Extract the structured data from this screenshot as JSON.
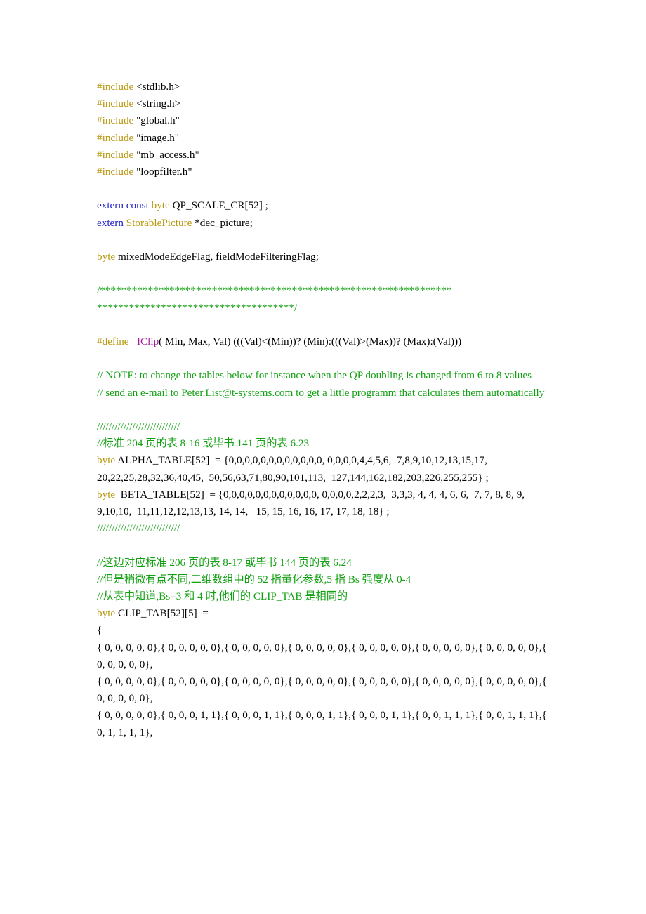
{
  "document": {
    "type": "source-code-listing",
    "language": "C",
    "page_background": "#ffffff",
    "colors": {
      "keyword": "#B8960C",
      "extern_keyword": "#2222CC",
      "macro_name": "#A0209C",
      "comment": "#12A012",
      "text": "#000000"
    }
  },
  "code": {
    "includes": [
      {
        "directive": "#include",
        "target": "<stdlib.h>"
      },
      {
        "directive": "#include",
        "target": "<string.h>"
      },
      {
        "directive": "#include",
        "target": "\"global.h\""
      },
      {
        "directive": "#include",
        "target": "\"image.h\""
      },
      {
        "directive": "#include",
        "target": "\"mb_access.h\""
      },
      {
        "directive": "#include",
        "target": "\"loopfilter.h\""
      }
    ],
    "externs": {
      "line1_kw": "extern const",
      "line1_type": "byte",
      "line1_rest": "QP_SCALE_CR[52] ;",
      "line2_kw": "extern",
      "line2_type": "StorablePicture",
      "line2_rest": "*dec_picture;"
    },
    "globals": {
      "type": "byte",
      "decl": "mixedModeEdgeFlag, fieldModeFilteringFlag;"
    },
    "banner": {
      "line1": "/******************************************************************",
      "line2": "*************************************/"
    },
    "define": {
      "directive": "#define",
      "name": "IClip",
      "body": "( Min, Max, Val) (((Val)<(Min))? (Min):(((Val)>(Max))? (Max):(Val)))"
    },
    "note_comment": {
      "line1": "// NOTE: to change the tables below for instance when the QP doubling is changed from 6 to 8 values",
      "line2": "//        send an e-mail to Peter.List@t-systems.com to get a little programm that calculates them automatically"
    },
    "separator_1": "////////////////////////////",
    "chinese_comment_1": "//标准 204 页的表 8-16 或毕书 141 页的表 6.23",
    "alpha_table": {
      "type": "byte",
      "name": "ALPHA_TABLE[52]",
      "assign": "=",
      "values": "{0,0,0,0,0,0,0,0,0,0,0,0, 0,0,0,0,4,4,5,6,  7,8,9,10,12,13,15,17,  20,22,25,28,32,36,40,45,  50,56,63,71,80,90,101,113,  127,144,162,182,203,226,255,255} ;"
    },
    "beta_table": {
      "type": "byte",
      "name": "BETA_TABLE[52]",
      "assign": "=",
      "values": "{0,0,0,0,0,0,0,0,0,0,0,0, 0,0,0,0,2,2,2,3,  3,3,3, 4, 4, 4, 6, 6,  7, 7, 8, 8, 9, 9,10,10,  11,11,12,12,13,13, 14, 14,   15, 15, 16, 16, 17, 17, 18, 18} ;"
    },
    "separator_2": "////////////////////////////",
    "chinese_comment_2": "//这边对应标准 206 页的表 8-17 或毕书 144 页的表 6.24",
    "chinese_comment_3": "//但是稍微有点不同,二维数组中的 52 指量化参数,5 指 Bs 强度从 0-4",
    "chinese_comment_4": "//从表中知道,Bs=3 和 4 时,他们的 CLIP_TAB 是相同的",
    "clip_tab": {
      "type": "byte",
      "name": "CLIP_TAB[52][5]",
      "assign": "=",
      "open_brace": "{",
      "rows": [
        "  { 0, 0, 0, 0, 0},{ 0, 0, 0, 0, 0},{ 0, 0, 0, 0, 0},{ 0, 0, 0, 0, 0},{ 0, 0, 0, 0, 0},{ 0, 0, 0, 0, 0},{ 0, 0, 0, 0, 0},{ 0, 0, 0, 0, 0},",
        "  { 0, 0, 0, 0, 0},{ 0, 0, 0, 0, 0},{ 0, 0, 0, 0, 0},{ 0, 0, 0, 0, 0},{ 0, 0, 0, 0, 0},{ 0, 0, 0, 0, 0},{ 0, 0, 0, 0, 0},{ 0, 0, 0, 0, 0},",
        "  { 0, 0, 0, 0, 0},{ 0, 0, 0, 1, 1},{ 0, 0, 0, 1, 1},{ 0, 0, 0, 1, 1},{ 0, 0, 0, 1, 1},{ 0, 0, 1, 1, 1},{ 0, 0, 1, 1, 1},{ 0, 1, 1, 1, 1},"
      ]
    }
  }
}
